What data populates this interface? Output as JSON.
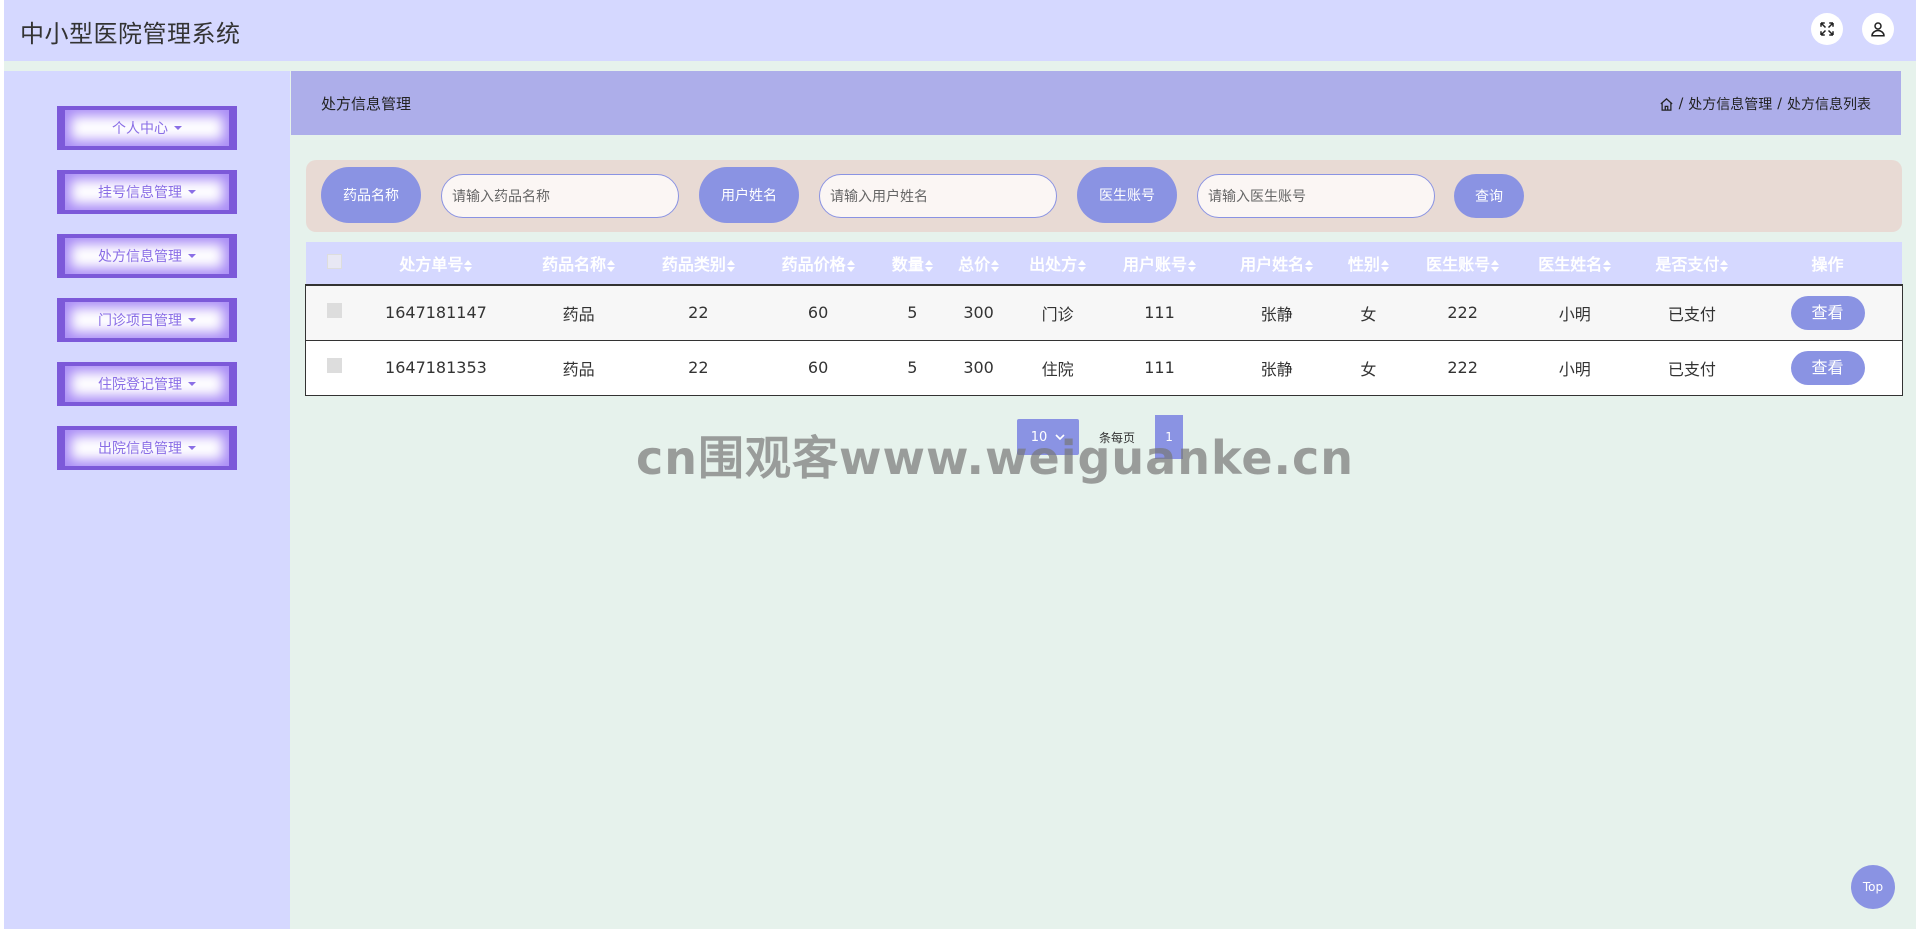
{
  "app": {
    "title": "中小型医院管理系统"
  },
  "topbar": {
    "fullscreen_icon": "expand-icon",
    "user_icon": "user-icon"
  },
  "sidebar": {
    "items": [
      {
        "label": "个人中心"
      },
      {
        "label": "挂号信息管理"
      },
      {
        "label": "处方信息管理"
      },
      {
        "label": "门诊项目管理"
      },
      {
        "label": "住院登记管理"
      },
      {
        "label": "出院信息管理"
      }
    ]
  },
  "header": {
    "title": "处方信息管理",
    "breadcrumb": [
      "处方信息管理",
      "处方信息列表"
    ],
    "separator": "/"
  },
  "search": {
    "fields": [
      {
        "label": "药品名称",
        "placeholder": "请输入药品名称"
      },
      {
        "label": "用户姓名",
        "placeholder": "请输入用户姓名"
      },
      {
        "label": "医生账号",
        "placeholder": "请输入医生账号"
      }
    ],
    "button": "查询"
  },
  "table": {
    "columns": [
      "处方单号",
      "药品名称",
      "药品类别",
      "药品价格",
      "数量",
      "总价",
      "出处方",
      "用户账号",
      "用户姓名",
      "性别",
      "医生账号",
      "医生姓名",
      "是否支付",
      "操作"
    ],
    "rows": [
      [
        "1647181147",
        "药品",
        "22",
        "60",
        "5",
        "300",
        "门诊",
        "111",
        "张静",
        "女",
        "222",
        "小明",
        "已支付"
      ],
      [
        "1647181353",
        "药品",
        "22",
        "60",
        "5",
        "300",
        "住院",
        "111",
        "张静",
        "女",
        "222",
        "小明",
        "已支付"
      ]
    ],
    "action_label": "查看"
  },
  "pager": {
    "page_size": "10",
    "per_page_label": "条每页",
    "current_page": "1"
  },
  "watermark": "cn围观客www.weiguanke.cn",
  "back_to_top": "Top",
  "colors": {
    "topbar": "#d5d8ff",
    "accent": "#8a93e3",
    "menu": "#7c59d9",
    "header": "#adaeea",
    "content_bg": "#e6f2ec"
  }
}
